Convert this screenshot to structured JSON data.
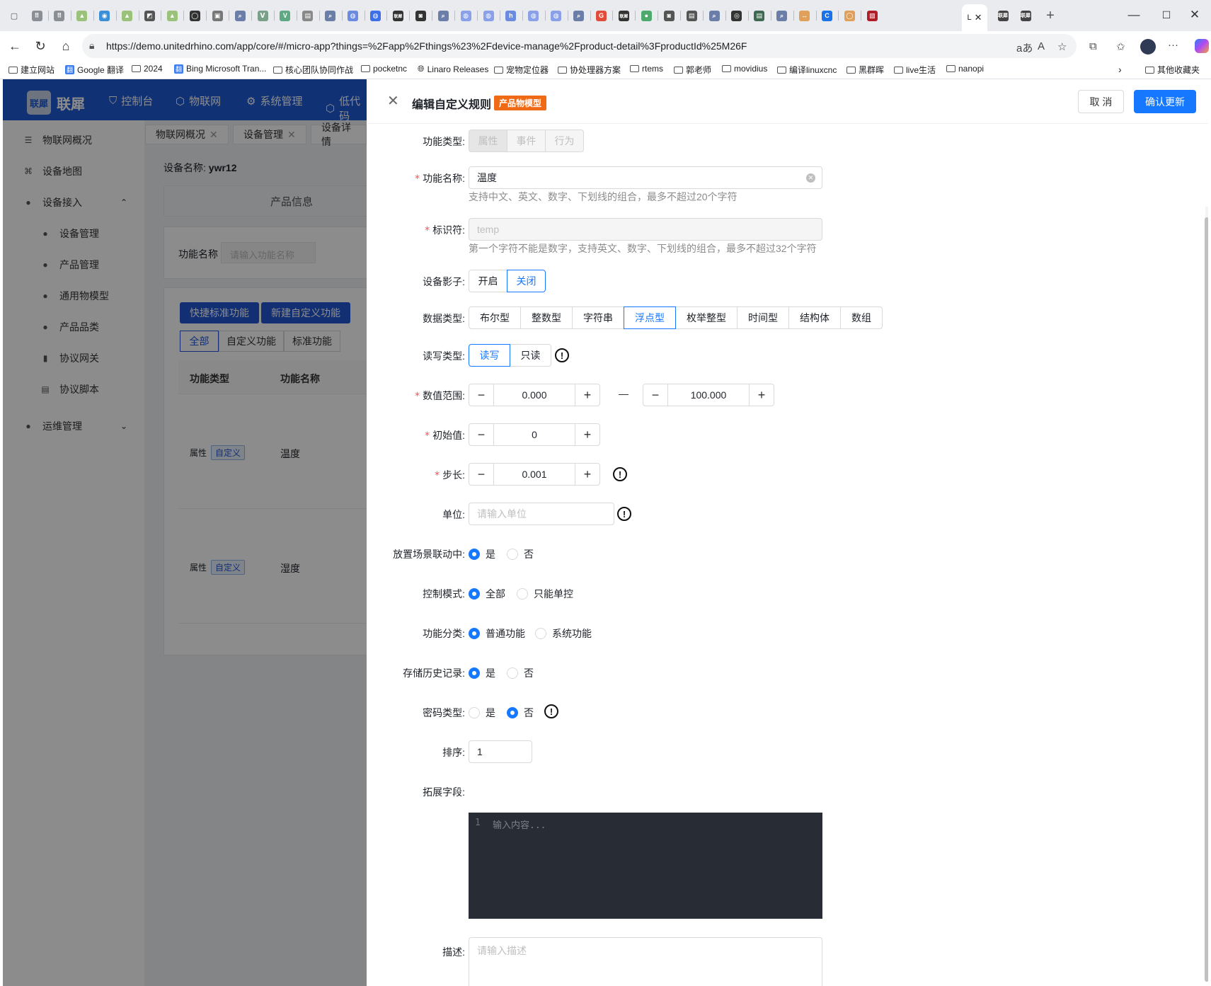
{
  "browser": {
    "url": "https://demo.unitedrhino.com/app/core/#/micro-app?things=%2Fapp%2Fthings%23%2Fdevice-manage%2Fproduct-detail%3FproductId%25M26F",
    "active_tab_label": "L",
    "tab_favicons": [
      "⠿",
      "⠿",
      "▲",
      "◉",
      "▲",
      "◩",
      "▲",
      "◯",
      "▣",
      "⌕",
      "ᐯ",
      "V",
      "▤",
      "⌕",
      "◍",
      "◍",
      "联犀",
      "◙",
      "⌕",
      "◍",
      "◍",
      "h",
      "◍",
      "◍",
      "⌕",
      "G",
      "联犀",
      "●",
      "◙",
      "▤",
      "⌕",
      "◎",
      "▤",
      "⌕",
      "↔",
      "C",
      "◯",
      "▧"
    ],
    "after_tabs": [
      "联犀",
      "联犀"
    ],
    "bookmarks": [
      {
        "label": "建立网站",
        "icon": "folder-icon"
      },
      {
        "label": "Google 翻译",
        "icon": "translate-icon"
      },
      {
        "label": "2024",
        "icon": "folder-icon"
      },
      {
        "label": "Bing Microsoft Tran...",
        "icon": "translate-icon"
      },
      {
        "label": "核心团队协同作战",
        "icon": "folder-icon"
      },
      {
        "label": "pocketnc",
        "icon": "folder-icon"
      },
      {
        "label": "Linaro Releases",
        "icon": "globe-icon"
      },
      {
        "label": "宠物定位器",
        "icon": "folder-icon"
      },
      {
        "label": "协处理器方案",
        "icon": "folder-icon"
      },
      {
        "label": "rtems",
        "icon": "folder-icon"
      },
      {
        "label": "郭老师",
        "icon": "folder-icon"
      },
      {
        "label": "movidius",
        "icon": "folder-icon"
      },
      {
        "label": "编译linuxcnc",
        "icon": "folder-icon"
      },
      {
        "label": "黑群晖",
        "icon": "folder-icon"
      },
      {
        "label": "live生活",
        "icon": "folder-icon"
      },
      {
        "label": "nanopi",
        "icon": "folder-icon"
      }
    ],
    "other_bookmarks": "其他收藏夹"
  },
  "app": {
    "logo_mark": "联犀",
    "logo_text": "联犀",
    "topnav": [
      "控制台",
      "物联网",
      "系统管理",
      "低代码"
    ],
    "sidebar": {
      "items": [
        "物联网概况",
        "设备地图",
        "设备接入"
      ],
      "sub_items": [
        "设备管理",
        "产品管理",
        "通用物模型",
        "产品品类",
        "协议网关",
        "协议脚本"
      ],
      "ops": "运维管理"
    },
    "page_tabs": [
      "物联网概况",
      "设备管理",
      "设备详情"
    ],
    "device_name_label": "设备名称:",
    "device_name": "ywr12",
    "product_info": "产品信息",
    "filter_label": "功能名称",
    "filter_placeholder": "请输入功能名称",
    "btn_quick": "快捷标准功能",
    "btn_new": "新建自定义功能",
    "filter_tabs": [
      "全部",
      "自定义功能",
      "标准功能"
    ],
    "table_headers": [
      "功能类型",
      "功能名称"
    ],
    "rows": [
      {
        "type": "属性",
        "tag": "自定义",
        "name": "温度"
      },
      {
        "type": "属性",
        "tag": "自定义",
        "name": "湿度"
      }
    ]
  },
  "drawer": {
    "title": "编辑自定义规则",
    "tag": "产品物模型",
    "cancel": "取 消",
    "confirm": "确认更新",
    "fields": {
      "func_type": {
        "label": "功能类型:",
        "options": [
          "属性",
          "事件",
          "行为"
        ],
        "selected": "属性"
      },
      "func_name": {
        "label": "功能名称:",
        "value": "温度",
        "hint": "支持中文、英文、数字、下划线的组合，最多不超过20个字符"
      },
      "identifier": {
        "label": "标识符:",
        "value": "temp",
        "hint": "第一个字符不能是数字，支持英文、数字、下划线的组合，最多不超过32个字符"
      },
      "shadow": {
        "label": "设备影子:",
        "options": [
          "开启",
          "关闭"
        ],
        "selected": "关闭"
      },
      "data_type": {
        "label": "数据类型:",
        "options": [
          "布尔型",
          "整数型",
          "字符串",
          "浮点型",
          "枚举整型",
          "时间型",
          "结构体",
          "数组"
        ],
        "selected": "浮点型"
      },
      "rw_type": {
        "label": "读写类型:",
        "options": [
          "读写",
          "只读"
        ],
        "selected": "读写"
      },
      "range": {
        "label": "数值范围:",
        "min": "0.000",
        "max": "100.000",
        "sep": "—"
      },
      "init": {
        "label": "初始值:",
        "value": "0"
      },
      "step": {
        "label": "步长:",
        "value": "0.001"
      },
      "unit": {
        "label": "单位:",
        "placeholder": "请输入单位"
      },
      "scene": {
        "label": "放置场景联动中:",
        "options": [
          "是",
          "否"
        ],
        "selected": "是"
      },
      "control": {
        "label": "控制模式:",
        "options": [
          "全部",
          "只能单控"
        ],
        "selected": "全部"
      },
      "category": {
        "label": "功能分类:",
        "options": [
          "普通功能",
          "系统功能"
        ],
        "selected": "普通功能"
      },
      "history": {
        "label": "存储历史记录:",
        "options": [
          "是",
          "否"
        ],
        "selected": "是"
      },
      "password": {
        "label": "密码类型:",
        "options": [
          "是",
          "否"
        ],
        "selected": "否"
      },
      "order": {
        "label": "排序:",
        "value": "1"
      },
      "ext": {
        "label": "拓展字段:",
        "line": "1",
        "placeholder": "输入内容..."
      },
      "desc": {
        "label": "描述:",
        "placeholder": "请输入描述"
      }
    }
  },
  "colors": {
    "primary": "#1677ff",
    "app_header": "#1f5ad5",
    "tag_orange": "#f06a16",
    "editor_bg": "#282c34",
    "required": "#ff4d4f"
  }
}
